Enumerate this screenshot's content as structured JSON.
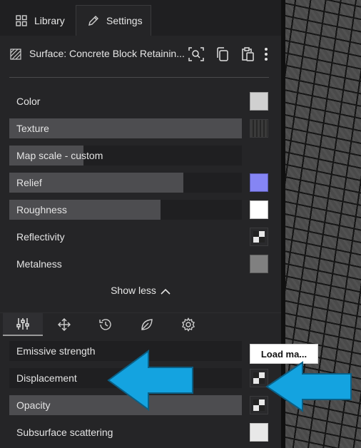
{
  "tabs": {
    "library": "Library",
    "settings": "Settings"
  },
  "header": {
    "title": "Surface: Concrete Block Retainin..."
  },
  "properties": [
    {
      "label": "Color",
      "fill": 0,
      "swatch": "#d0d0d0"
    },
    {
      "label": "Texture",
      "fill": 1.0,
      "swatch": "texture"
    },
    {
      "label": "Map scale - custom",
      "fill": 0.32,
      "swatch": ""
    },
    {
      "label": "Relief",
      "fill": 0.75,
      "swatch": "#8585f4"
    },
    {
      "label": "Roughness",
      "fill": 0.65,
      "swatch": "#ffffff"
    },
    {
      "label": "Reflectivity",
      "fill": 0,
      "swatch": "checker"
    },
    {
      "label": "Metalness",
      "fill": 0,
      "swatch": "#808080"
    }
  ],
  "show_less": "Show less",
  "lower_tabs": [
    "sliders-icon",
    "move-icon",
    "history-icon",
    "leaf-icon",
    "gear-icon"
  ],
  "lower_properties": [
    {
      "label": "Emissive strength",
      "fill": 0
    },
    {
      "label": "Displacement",
      "fill": 0
    },
    {
      "label": "Opacity",
      "fill": 1.0
    },
    {
      "label": "Subsurface scattering",
      "fill": 0
    }
  ],
  "load_map_button": "Load ma...",
  "colors": {
    "panel": "#252527",
    "row_bg": "#1f1f21",
    "fill": "#4d4d50",
    "arrow": "#14a3e0"
  }
}
